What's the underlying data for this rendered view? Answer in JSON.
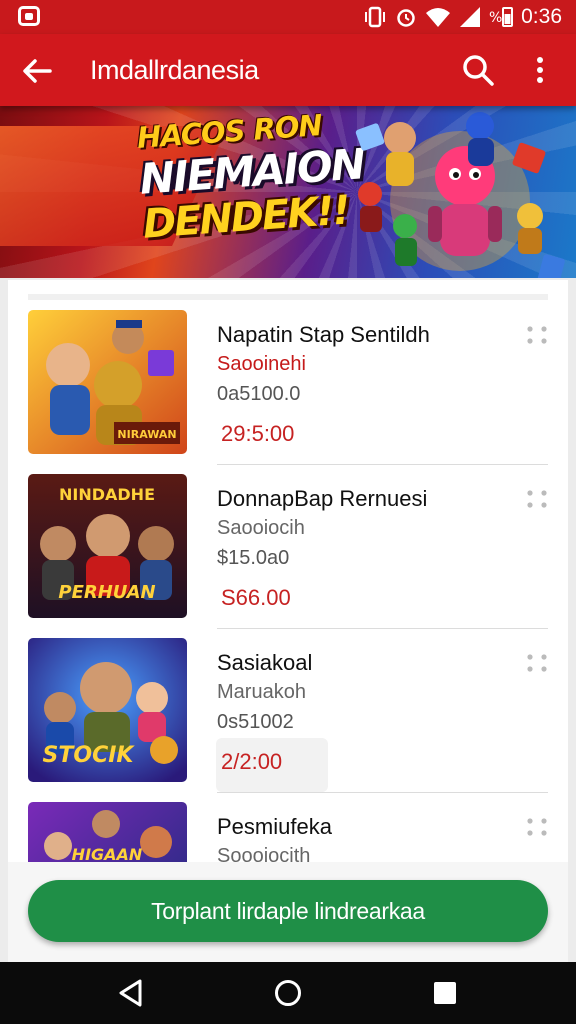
{
  "status_bar": {
    "time": "0:36",
    "battery_icon": "battery-icon",
    "wifi_icon": "wifi-icon",
    "signal_icon": "signal-icon",
    "notification_icon": "notification-icon"
  },
  "toolbar": {
    "title": "Imdallrdanesia",
    "back_icon": "arrow-back-icon",
    "search_icon": "search-icon",
    "more_icon": "more-vert-icon"
  },
  "banner": {
    "line1": "HACOS RON",
    "line2": "NIEMAION",
    "line3": "DENDEK!!"
  },
  "items": [
    {
      "name": "Napatin Stap Sentildh",
      "subtitle": "Saooinehi",
      "subtitle_red": true,
      "original_price": "0a5100.0",
      "price": "29:5:00",
      "price_highlight": false,
      "thumb_text": "NIRAWAN",
      "thumb_colors": [
        "#f2a51c",
        "#d04a12"
      ]
    },
    {
      "name": "DonnapBap Rernuesi",
      "subtitle": "Saooiocih",
      "subtitle_red": false,
      "original_price": "$15.0a0",
      "price": "S66.00",
      "price_highlight": false,
      "thumb_text": "NINDADHE",
      "thumb_text2": "PERHUAN",
      "thumb_colors": [
        "#8a2a14",
        "#2a1420"
      ]
    },
    {
      "name": "Sasiakoal",
      "subtitle": "Maruakoh",
      "subtitle_red": false,
      "original_price": "0s51002",
      "price": "2/2:00",
      "price_highlight": true,
      "thumb_text": "STOCIK",
      "thumb_colors": [
        "#2b6fe0",
        "#3a1a8a"
      ]
    },
    {
      "name": "Pesmiufeka",
      "subtitle": "Soooiocith",
      "subtitle_red": false,
      "original_price": "",
      "price": "",
      "price_highlight": false,
      "thumb_text": "HIGAAN",
      "thumb_colors": [
        "#6a2aa8",
        "#1e2a7a"
      ]
    }
  ],
  "cta": {
    "label": "Torplant lirdaple lindrearkaa"
  },
  "nav": {
    "back": "nav-back-icon",
    "home": "nav-home-icon",
    "recents": "nav-recents-icon"
  },
  "colors": {
    "toolbar": "#d1181d",
    "status_bar": "#c8191c",
    "cta": "#1f8f47",
    "price": "#c62222"
  }
}
